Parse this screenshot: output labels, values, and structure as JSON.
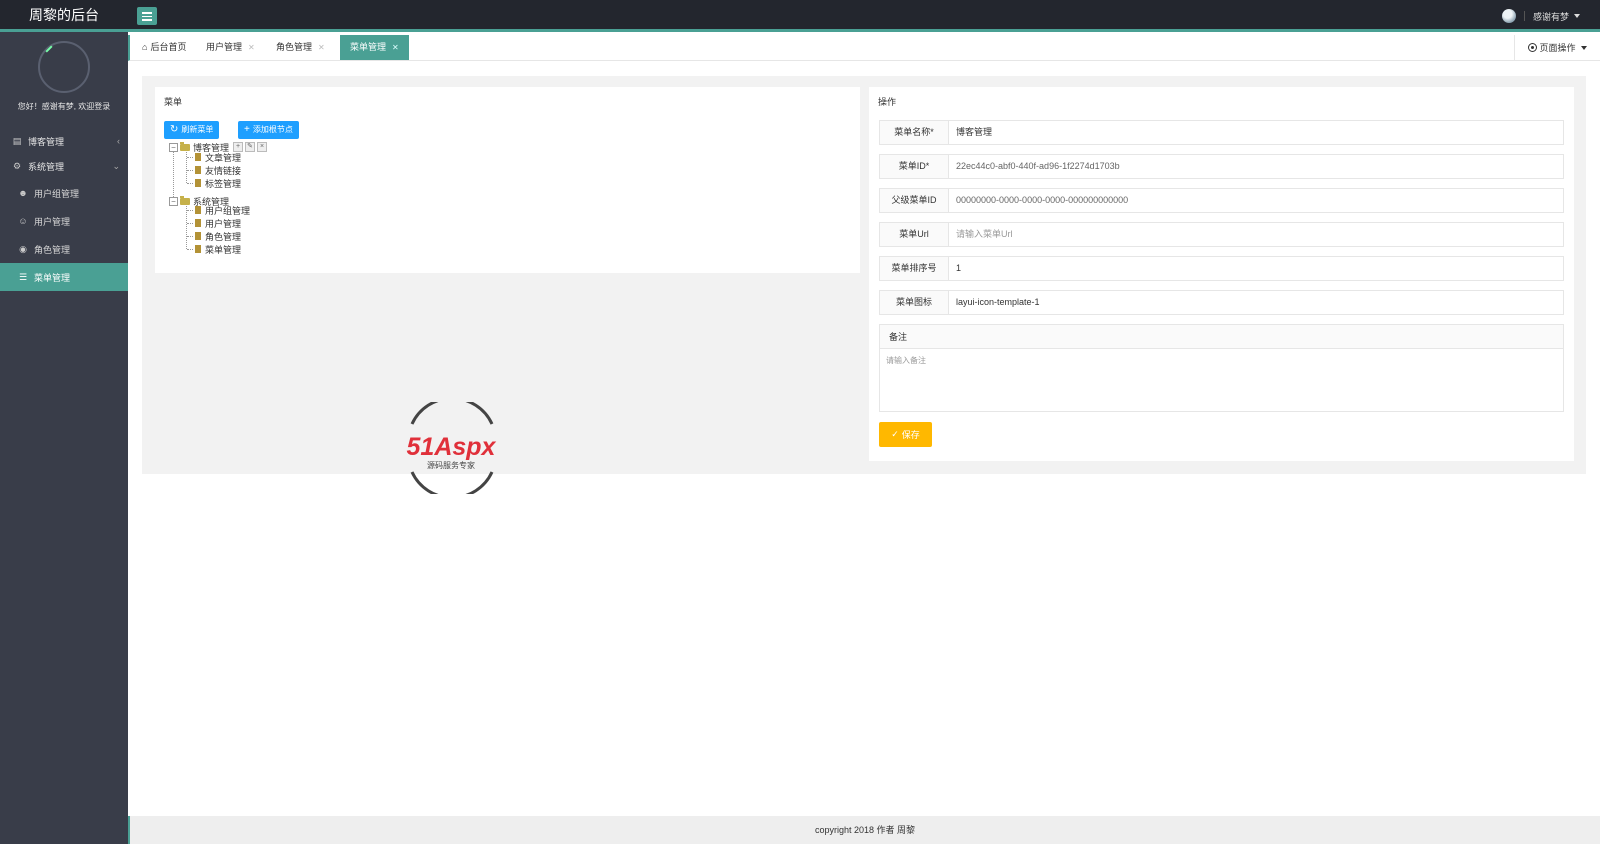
{
  "header": {
    "title": "周黎的后台",
    "user_name": "感谢有梦"
  },
  "sidebar": {
    "welcome": "您好！感谢有梦, 欢迎登录",
    "items": [
      {
        "label": "博客管理",
        "icon": "blog-icon"
      },
      {
        "label": "系统管理",
        "icon": "gear-icon"
      },
      {
        "label": "用户组管理",
        "icon": "user-group-icon"
      },
      {
        "label": "用户管理",
        "icon": "user-icon"
      },
      {
        "label": "角色管理",
        "icon": "role-icon"
      },
      {
        "label": "菜单管理",
        "icon": "menu-icon"
      }
    ]
  },
  "tabs": [
    {
      "label": "后台首页"
    },
    {
      "label": "用户管理"
    },
    {
      "label": "角色管理"
    },
    {
      "label": "菜单管理"
    }
  ],
  "page_ops": "页面操作",
  "left_panel": {
    "title": "菜单",
    "refresh_btn": "刷新菜单",
    "add_root_btn": "添加根节点",
    "tree": {
      "root1": "博客管理",
      "root1_children": [
        "文章管理",
        "友情链接",
        "标签管理"
      ],
      "root2": "系统管理",
      "root2_children": [
        "用户组管理",
        "用户管理",
        "角色管理",
        "菜单管理"
      ]
    }
  },
  "right_panel": {
    "title": "操作",
    "fields": [
      {
        "label": "菜单名称*",
        "value": "博客管理"
      },
      {
        "label": "菜单ID*",
        "value": "22ec44c0-abf0-440f-ad96-1f2274d1703b"
      },
      {
        "label": "父级菜单ID",
        "value": "00000000-0000-0000-0000-000000000000"
      },
      {
        "label": "菜单Url",
        "placeholder": "请输入菜单Url"
      },
      {
        "label": "菜单排序号",
        "value": "1"
      },
      {
        "label": "菜单图标",
        "value": "layui-icon-template-1"
      }
    ],
    "remark_label": "备注",
    "remark_placeholder": "请输入备注",
    "save_btn": "保存"
  },
  "watermark": {
    "brand": "51Aspx",
    "slogan": "源码服务专家"
  },
  "footer": "copyright 2018 作者 周黎",
  "colors": {
    "header_bg": "#23262e",
    "sidebar_bg": "#393d49",
    "accent": "#4aa094",
    "primary_btn": "#1e9fff",
    "save_btn": "#ffb800"
  }
}
